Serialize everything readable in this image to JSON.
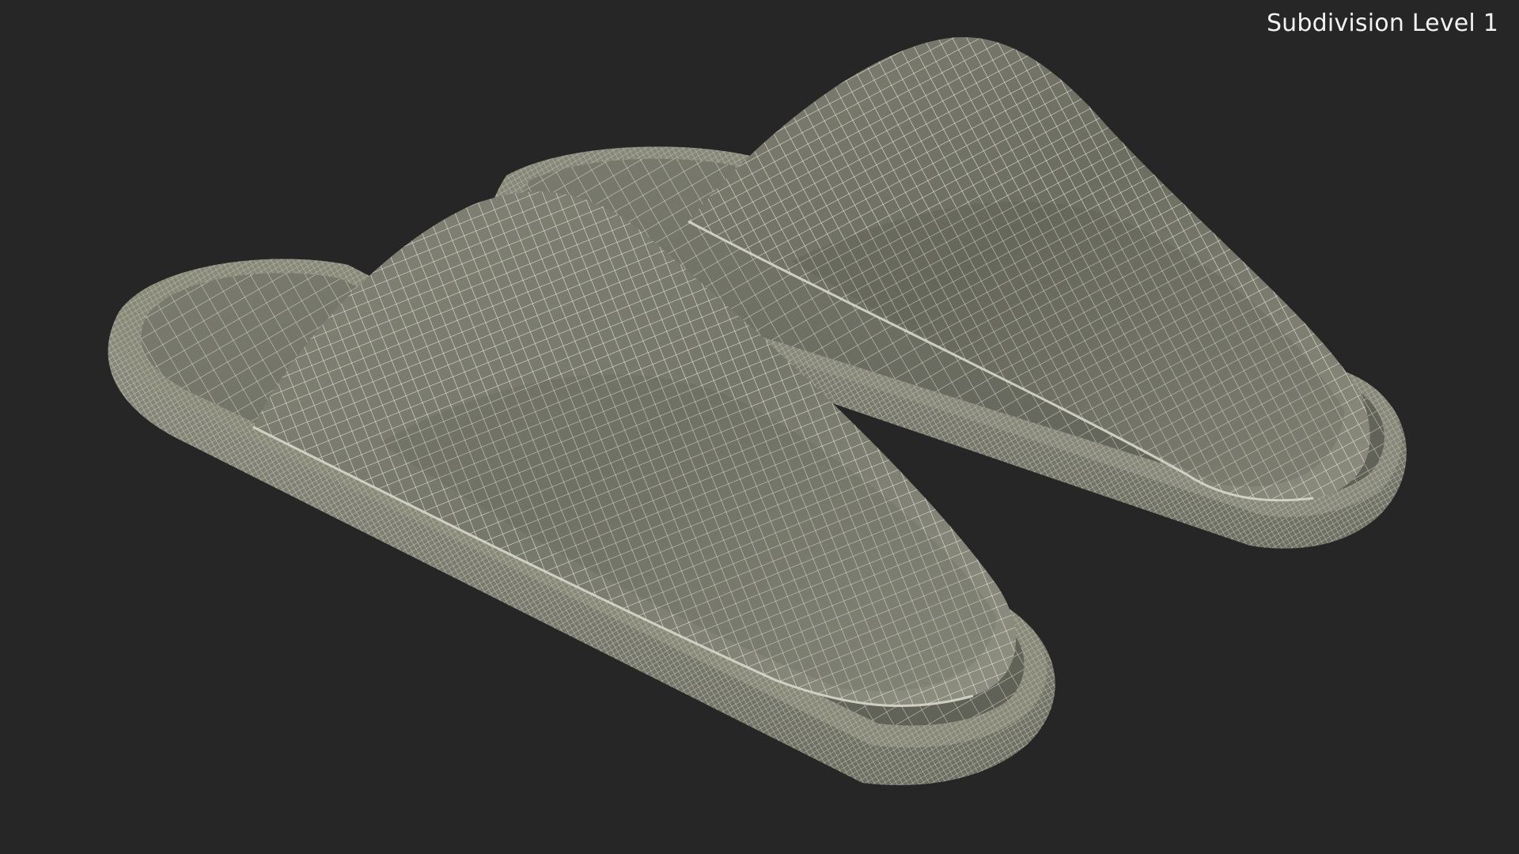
{
  "overlay": {
    "label": "Subdivision Level 1"
  },
  "scene": {
    "subject": "slippers-pair",
    "render_mode": "wireframe",
    "colors": {
      "background": "#262626",
      "surface_light": "#8a8b7c",
      "surface_mid": "#75766a",
      "surface_dark": "#5d5e54",
      "wire": "#e9e9dc",
      "wire_dense": "#cfd0c2"
    }
  }
}
